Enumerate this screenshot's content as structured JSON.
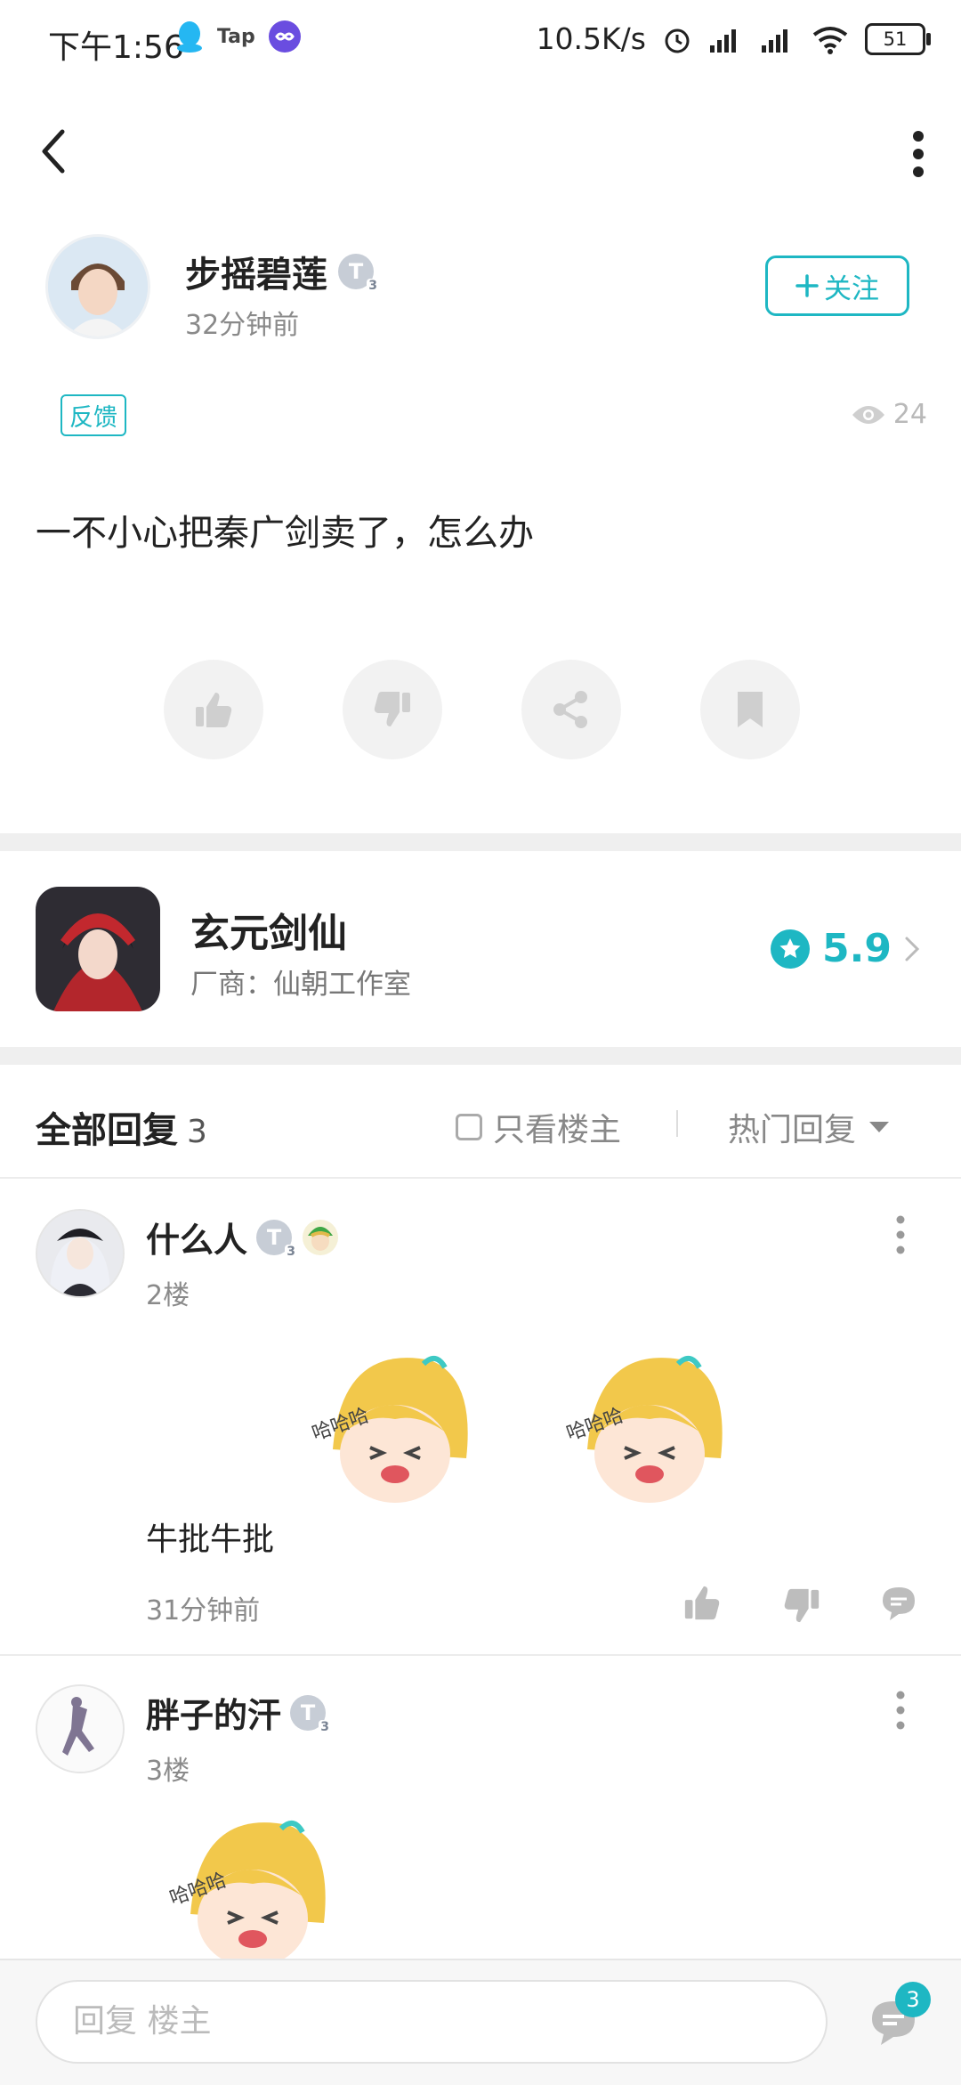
{
  "status_bar": {
    "time": "下午1:56",
    "app_icons": [
      "qq-icon",
      "taptap-icon",
      "link-icon"
    ],
    "tap_label": "Tap",
    "network_speed": "10.5K/s",
    "battery": "51"
  },
  "post": {
    "author": {
      "name": "步摇碧莲",
      "time": "32分钟前",
      "badge": "T",
      "badge_level": "3"
    },
    "follow_label": "关注",
    "tag": "反馈",
    "views": "24",
    "content": "一不小心把秦广剑卖了，怎么办"
  },
  "game": {
    "name": "玄元剑仙",
    "developer": "厂商：仙朝工作室",
    "rating": "5.9"
  },
  "replies_header": {
    "title": "全部回复",
    "count": "3",
    "only_host_label": "只看楼主",
    "sort_label": "热门回复"
  },
  "comments": [
    {
      "name": "什么人",
      "badge": "T",
      "badge_level": "3",
      "floor": "2楼",
      "text": "牛批牛批",
      "time": "31分钟前"
    },
    {
      "name": "胖子的汗",
      "badge": "T",
      "badge_level": "3",
      "floor": "3楼"
    }
  ],
  "reply_bar": {
    "placeholder": "回复 楼主",
    "message_count": "3"
  },
  "colors": {
    "accent": "#1eb7c3",
    "divider": "#efefef",
    "muted_text": "#8a8a8a"
  }
}
